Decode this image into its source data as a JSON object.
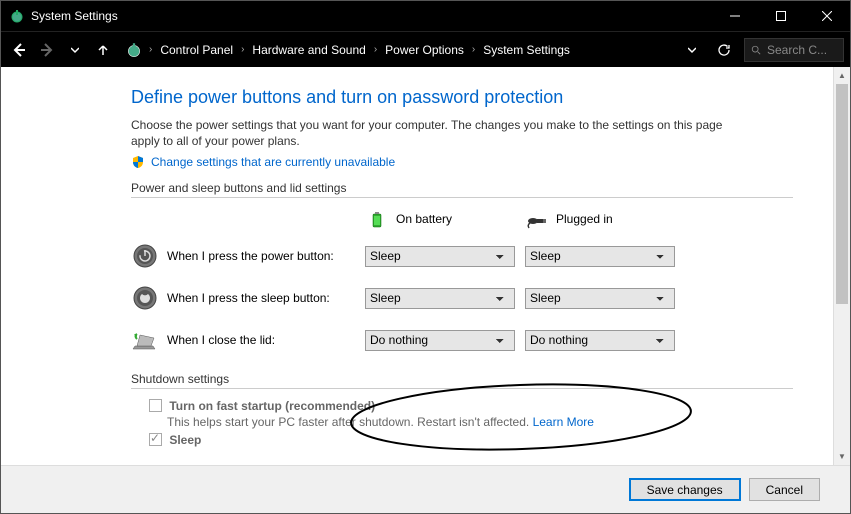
{
  "window": {
    "title": "System Settings"
  },
  "breadcrumbs": {
    "items": [
      "Control Panel",
      "Hardware and Sound",
      "Power Options",
      "System Settings"
    ]
  },
  "search": {
    "placeholder": "Search C..."
  },
  "page": {
    "heading": "Define power buttons and turn on password protection",
    "description": "Choose the power settings that you want for your computer. The changes you make to the settings on this page apply to all of your power plans.",
    "change_link": "Change settings that are currently unavailable"
  },
  "buttons_section": {
    "label": "Power and sleep buttons and lid settings",
    "col_battery": "On battery",
    "col_plugged": "Plugged in",
    "rows": [
      {
        "label": "When I press the power button:",
        "battery": "Sleep",
        "plugged": "Sleep"
      },
      {
        "label": "When I press the sleep button:",
        "battery": "Sleep",
        "plugged": "Sleep"
      },
      {
        "label": "When I close the lid:",
        "battery": "Do nothing",
        "plugged": "Do nothing"
      }
    ]
  },
  "shutdown_section": {
    "label": "Shutdown settings",
    "fast_startup_label": "Turn on fast startup (recommended)",
    "fast_startup_help": "This helps start your PC faster after shutdown. Restart isn't affected. ",
    "learn_more": "Learn More",
    "sleep_label": "Sleep"
  },
  "footer": {
    "save": "Save changes",
    "cancel": "Cancel"
  }
}
